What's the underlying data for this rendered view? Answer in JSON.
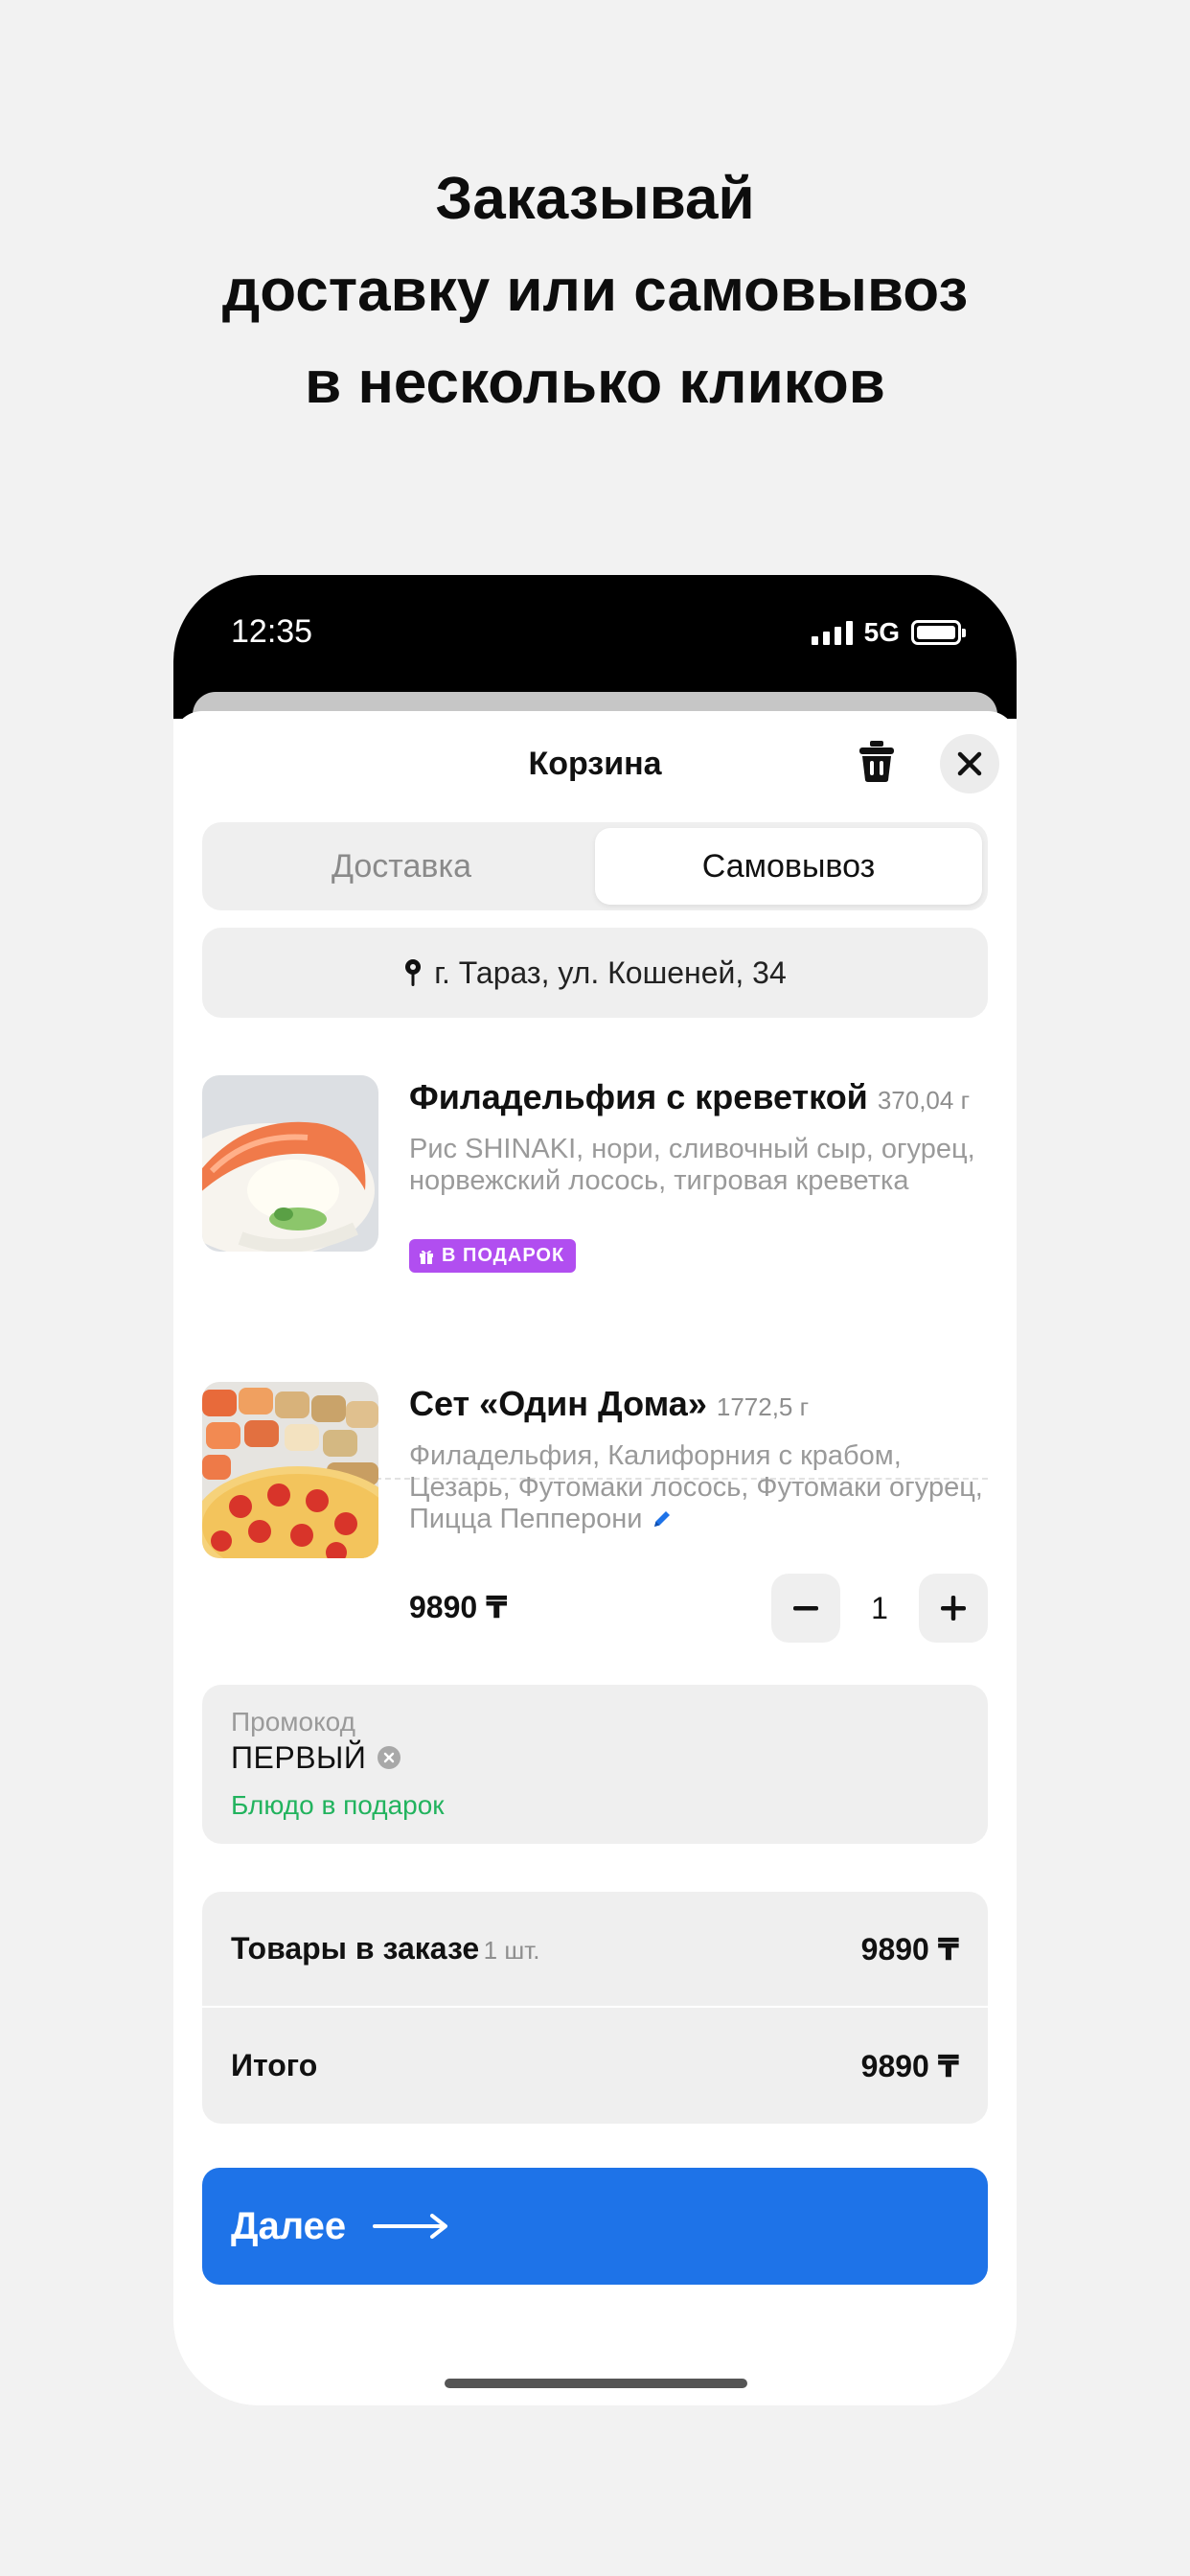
{
  "headline": {
    "line1": "Заказывай",
    "line2": "доставку или самовывоз",
    "line3": "в несколько кликов"
  },
  "status_bar": {
    "time": "12:35",
    "network": "5G"
  },
  "cart": {
    "title": "Корзина",
    "tabs": [
      {
        "label": "Доставка",
        "selected": false
      },
      {
        "label": "Самовывоз",
        "selected": true
      }
    ],
    "address": "г. Тараз, ул. Кошеней, 34",
    "items": [
      {
        "title": "Филадельфия с креветкой",
        "weight": "370,04 г",
        "description": "Рис SHINAKI, нори, сливочный сыр, огурец, норвежский лосось, тигровая креветка",
        "badge": "В ПОДАРОК"
      },
      {
        "title": "Сет «Один Дома»",
        "weight": "1772,5 г",
        "description": "Филадельфия, Калифорния с крабом, Цезарь, Футомаки лосось, Футомаки огурец, Пицца Пепперони",
        "price": "9890 ₸",
        "quantity": "1"
      }
    ],
    "promo": {
      "label": "Промокод",
      "code": "ПЕРВЫЙ",
      "result": "Блюдо в подарок"
    },
    "summary": {
      "items_label": "Товары в заказе",
      "items_count": "1 шт.",
      "items_total": "9890 ₸",
      "total_label": "Итого",
      "total_value": "9890 ₸"
    },
    "next_button": "Далее"
  },
  "colors": {
    "accent": "#1e73e8",
    "gift_badge": "#b14ef0",
    "promo_success": "#22b35e",
    "background": "#f2f2f2"
  }
}
